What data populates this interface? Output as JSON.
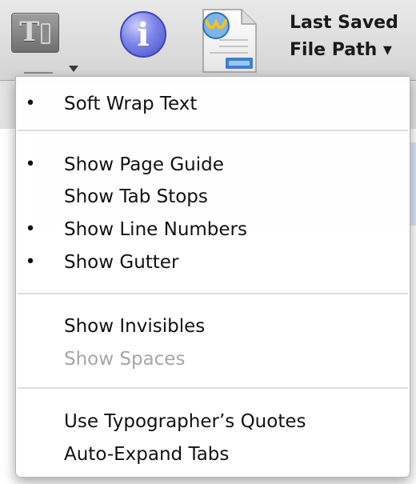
{
  "toolbar": {
    "status_line_1": "Last Saved",
    "status_line_2": "File Path ▾"
  },
  "menu": {
    "items": [
      {
        "label": "Soft Wrap Text",
        "checked": "•"
      },
      {
        "label": "Show Page Guide",
        "checked": "•"
      },
      {
        "label": "Show Tab Stops",
        "checked": ""
      },
      {
        "label": "Show Line Numbers",
        "checked": "•"
      },
      {
        "label": "Show Gutter",
        "checked": "•"
      },
      {
        "label": "Show Invisibles",
        "checked": ""
      },
      {
        "label": "Show Spaces",
        "checked": "",
        "disabled": true
      },
      {
        "label": "Use Typographer’s Quotes",
        "checked": ""
      },
      {
        "label": "Auto-Expand Tabs",
        "checked": ""
      }
    ]
  },
  "colors": {
    "menu_background": "#ffffff",
    "disabled_text": "#a6a6a6",
    "info_icon_blue": "#4a4fcf"
  }
}
